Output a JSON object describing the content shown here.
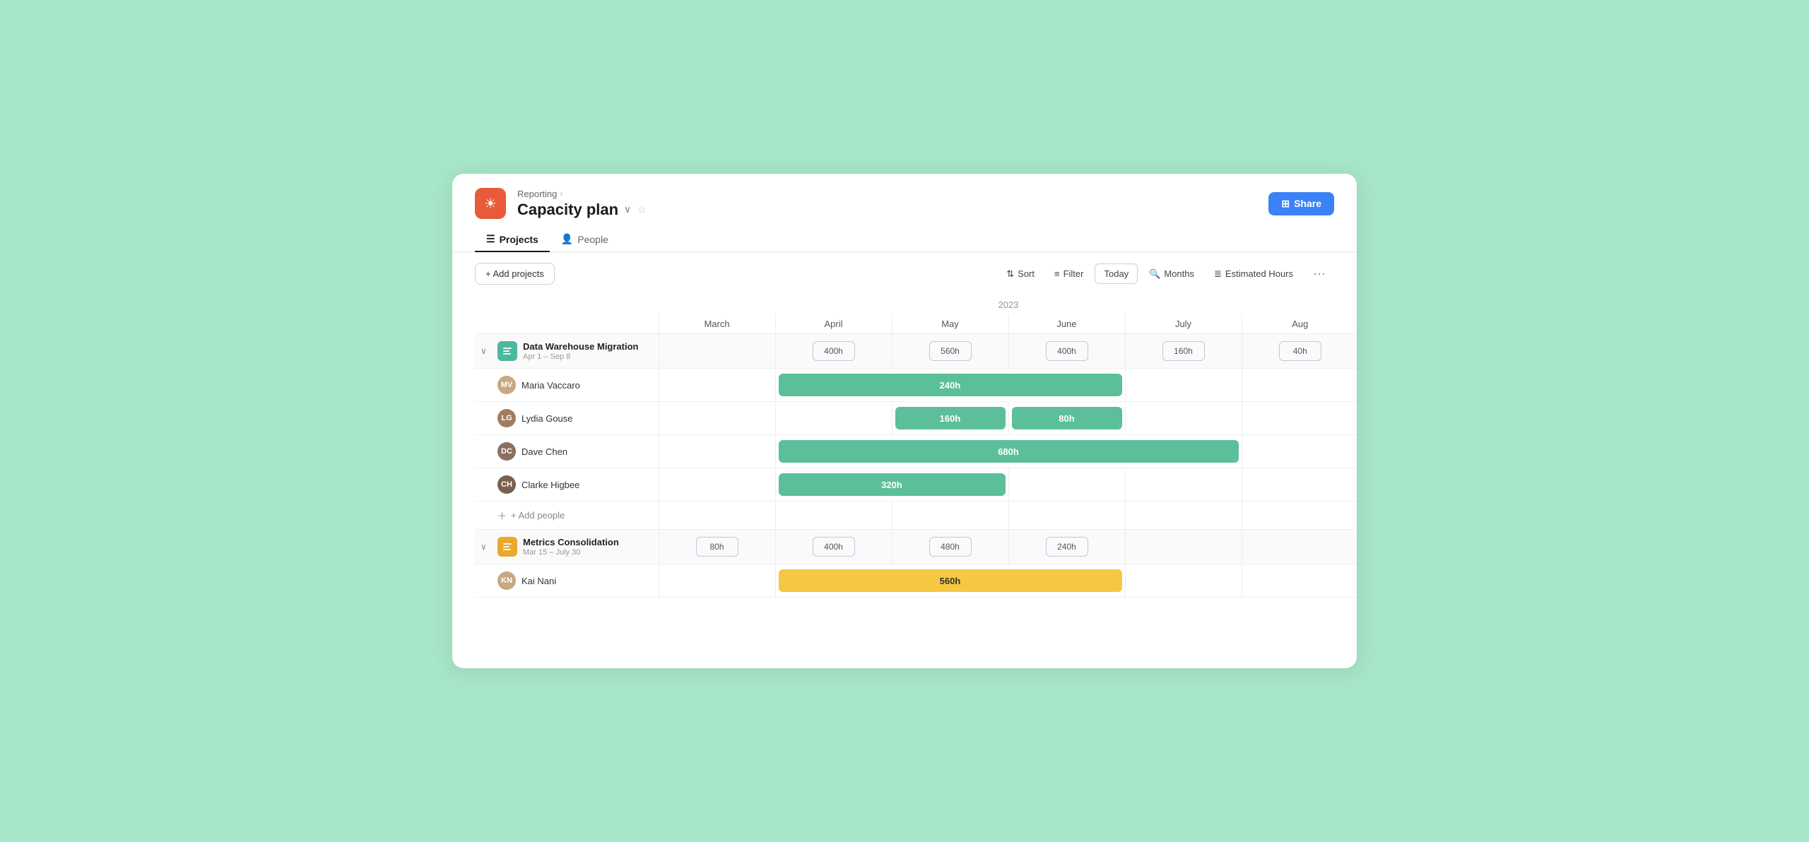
{
  "app": {
    "icon": "☀",
    "breadcrumb": "Reporting",
    "title": "Capacity plan",
    "share_label": "Share"
  },
  "tabs": [
    {
      "id": "projects",
      "label": "Projects",
      "icon": "☰",
      "active": true
    },
    {
      "id": "people",
      "label": "People",
      "icon": "👤",
      "active": false
    }
  ],
  "toolbar": {
    "add_projects": "+ Add projects",
    "sort": "Sort",
    "filter": "Filter",
    "today": "Today",
    "months": "Months",
    "estimated_hours": "Estimated Hours"
  },
  "year": "2023",
  "months": [
    "March",
    "April",
    "May",
    "June",
    "July",
    "Aug"
  ],
  "projects": [
    {
      "name": "Data Warehouse Migration",
      "dates": "Apr 1 – Sep 8",
      "icon_bg": "#4db89e",
      "icon_char": "⠿",
      "hours_by_month": [
        "",
        "400h",
        "560h",
        "400h",
        "160h",
        "40h"
      ],
      "people": [
        {
          "name": "Maria Vaccaro",
          "avatar_color": "#c7a882",
          "bar_start": 1,
          "bar_span": 3,
          "hours": "240h",
          "bar_color": "bar-green"
        },
        {
          "name": "Lydia Gouse",
          "avatar_color": "#a07c5f",
          "bar_start": 2,
          "bar_span": 1,
          "hours": "160h",
          "bar2_start": 3,
          "bar2_span": 1,
          "bar2_hours": "80h",
          "bar_color": "bar-green"
        },
        {
          "name": "Dave Chen",
          "avatar_color": "#7a6a5a",
          "bar_start": 1,
          "bar_span": 4,
          "hours": "680h",
          "bar_color": "bar-green"
        },
        {
          "name": "Clarke Higbee",
          "avatar_color": "#8c7060",
          "bar_start": 1,
          "bar_span": 2,
          "hours": "320h",
          "bar_color": "bar-green"
        }
      ],
      "add_person": "+ Add people"
    },
    {
      "name": "Metrics Consolidation",
      "dates": "Mar 15 – July 30",
      "icon_bg": "#e8a830",
      "icon_char": "⠿",
      "hours_by_month": [
        "80h",
        "400h",
        "480h",
        "240h",
        "",
        ""
      ],
      "people": [
        {
          "name": "Kai Nani",
          "avatar_color": "#c7a882",
          "bar_start": 1,
          "bar_span": 3,
          "hours": "560h",
          "bar_color": "bar-yellow"
        }
      ],
      "add_person": "+ Add people"
    }
  ]
}
